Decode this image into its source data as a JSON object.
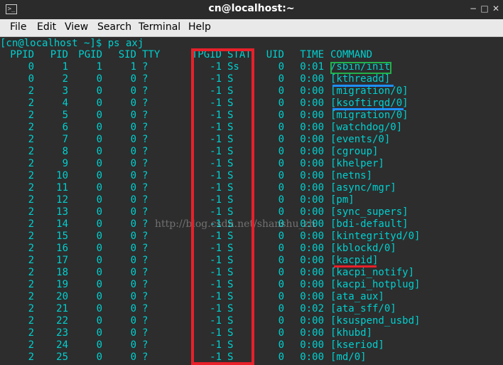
{
  "window": {
    "title": "cn@localhost:~",
    "minimize_glyph": "−",
    "maximize_glyph": "□",
    "close_glyph": "✕",
    "terminal_icon_glyph": ">_"
  },
  "menu": [
    "File",
    "Edit",
    "View",
    "Search",
    "Terminal",
    "Help"
  ],
  "terminal": {
    "prompt": "[cn@localhost ~]$ ps axj",
    "headers": {
      "ppid": "PPID",
      "pid": "PID",
      "pgid": "PGID",
      "sid": "SID",
      "tty": "TTY",
      "tpgid": "TPGID",
      "stat": "STAT",
      "uid": "UID",
      "time": "TIME",
      "command": "COMMAND"
    },
    "rows": [
      {
        "ppid": "0",
        "pid": "1",
        "pgid": "1",
        "sid": "1",
        "tty": "?",
        "tpgid": "-1",
        "stat": "Ss",
        "uid": "0",
        "time": "0:01",
        "command": "/sbin/init"
      },
      {
        "ppid": "0",
        "pid": "2",
        "pgid": "0",
        "sid": "0",
        "tty": "?",
        "tpgid": "-1",
        "stat": "S",
        "uid": "0",
        "time": "0:00",
        "command": "[kthreadd]"
      },
      {
        "ppid": "2",
        "pid": "3",
        "pgid": "0",
        "sid": "0",
        "tty": "?",
        "tpgid": "-1",
        "stat": "S",
        "uid": "0",
        "time": "0:00",
        "command": "[migration/0]"
      },
      {
        "ppid": "2",
        "pid": "4",
        "pgid": "0",
        "sid": "0",
        "tty": "?",
        "tpgid": "-1",
        "stat": "S",
        "uid": "0",
        "time": "0:00",
        "command": "[ksoftirqd/0]"
      },
      {
        "ppid": "2",
        "pid": "5",
        "pgid": "0",
        "sid": "0",
        "tty": "?",
        "tpgid": "-1",
        "stat": "S",
        "uid": "0",
        "time": "0:00",
        "command": "[migration/0]"
      },
      {
        "ppid": "2",
        "pid": "6",
        "pgid": "0",
        "sid": "0",
        "tty": "?",
        "tpgid": "-1",
        "stat": "S",
        "uid": "0",
        "time": "0:00",
        "command": "[watchdog/0]"
      },
      {
        "ppid": "2",
        "pid": "7",
        "pgid": "0",
        "sid": "0",
        "tty": "?",
        "tpgid": "-1",
        "stat": "S",
        "uid": "0",
        "time": "0:00",
        "command": "[events/0]"
      },
      {
        "ppid": "2",
        "pid": "8",
        "pgid": "0",
        "sid": "0",
        "tty": "?",
        "tpgid": "-1",
        "stat": "S",
        "uid": "0",
        "time": "0:00",
        "command": "[cgroup]"
      },
      {
        "ppid": "2",
        "pid": "9",
        "pgid": "0",
        "sid": "0",
        "tty": "?",
        "tpgid": "-1",
        "stat": "S",
        "uid": "0",
        "time": "0:00",
        "command": "[khelper]"
      },
      {
        "ppid": "2",
        "pid": "10",
        "pgid": "0",
        "sid": "0",
        "tty": "?",
        "tpgid": "-1",
        "stat": "S",
        "uid": "0",
        "time": "0:00",
        "command": "[netns]"
      },
      {
        "ppid": "2",
        "pid": "11",
        "pgid": "0",
        "sid": "0",
        "tty": "?",
        "tpgid": "-1",
        "stat": "S",
        "uid": "0",
        "time": "0:00",
        "command": "[async/mgr]"
      },
      {
        "ppid": "2",
        "pid": "12",
        "pgid": "0",
        "sid": "0",
        "tty": "?",
        "tpgid": "-1",
        "stat": "S",
        "uid": "0",
        "time": "0:00",
        "command": "[pm]"
      },
      {
        "ppid": "2",
        "pid": "13",
        "pgid": "0",
        "sid": "0",
        "tty": "?",
        "tpgid": "-1",
        "stat": "S",
        "uid": "0",
        "time": "0:00",
        "command": "[sync_supers]"
      },
      {
        "ppid": "2",
        "pid": "14",
        "pgid": "0",
        "sid": "0",
        "tty": "?",
        "tpgid": "-1",
        "stat": "S",
        "uid": "0",
        "time": "0:00",
        "command": "[bdi-default]"
      },
      {
        "ppid": "2",
        "pid": "15",
        "pgid": "0",
        "sid": "0",
        "tty": "?",
        "tpgid": "-1",
        "stat": "S",
        "uid": "0",
        "time": "0:00",
        "command": "[kintegrityd/0]"
      },
      {
        "ppid": "2",
        "pid": "16",
        "pgid": "0",
        "sid": "0",
        "tty": "?",
        "tpgid": "-1",
        "stat": "S",
        "uid": "0",
        "time": "0:00",
        "command": "[kblockd/0]"
      },
      {
        "ppid": "2",
        "pid": "17",
        "pgid": "0",
        "sid": "0",
        "tty": "?",
        "tpgid": "-1",
        "stat": "S",
        "uid": "0",
        "time": "0:00",
        "command": "[kacpid]"
      },
      {
        "ppid": "2",
        "pid": "18",
        "pgid": "0",
        "sid": "0",
        "tty": "?",
        "tpgid": "-1",
        "stat": "S",
        "uid": "0",
        "time": "0:00",
        "command": "[kacpi_notify]"
      },
      {
        "ppid": "2",
        "pid": "19",
        "pgid": "0",
        "sid": "0",
        "tty": "?",
        "tpgid": "-1",
        "stat": "S",
        "uid": "0",
        "time": "0:00",
        "command": "[kacpi_hotplug]"
      },
      {
        "ppid": "2",
        "pid": "20",
        "pgid": "0",
        "sid": "0",
        "tty": "?",
        "tpgid": "-1",
        "stat": "S",
        "uid": "0",
        "time": "0:00",
        "command": "[ata_aux]"
      },
      {
        "ppid": "2",
        "pid": "21",
        "pgid": "0",
        "sid": "0",
        "tty": "?",
        "tpgid": "-1",
        "stat": "S",
        "uid": "0",
        "time": "0:02",
        "command": "[ata_sff/0]"
      },
      {
        "ppid": "2",
        "pid": "22",
        "pgid": "0",
        "sid": "0",
        "tty": "?",
        "tpgid": "-1",
        "stat": "S",
        "uid": "0",
        "time": "0:00",
        "command": "[ksuspend_usbd]"
      },
      {
        "ppid": "2",
        "pid": "23",
        "pgid": "0",
        "sid": "0",
        "tty": "?",
        "tpgid": "-1",
        "stat": "S",
        "uid": "0",
        "time": "0:00",
        "command": "[khubd]"
      },
      {
        "ppid": "2",
        "pid": "24",
        "pgid": "0",
        "sid": "0",
        "tty": "?",
        "tpgid": "-1",
        "stat": "S",
        "uid": "0",
        "time": "0:00",
        "command": "[kseriod]"
      },
      {
        "ppid": "2",
        "pid": "25",
        "pgid": "0",
        "sid": "0",
        "tty": "?",
        "tpgid": "-1",
        "stat": "S",
        "uid": "0",
        "time": "0:00",
        "command": "[md/0]"
      }
    ]
  },
  "watermark": "http://blog.csdn.net/shanshu_zh",
  "colors": {
    "terminal_bg": "#2d2d2d",
    "terminal_text": "#00d0d0",
    "titlebar_bg": "#2b2b2b",
    "menubar_bg": "#e9e9e9",
    "highlight_red": "#e8202a",
    "highlight_green": "#22b14c",
    "underline_blue": "#1e90ff"
  }
}
